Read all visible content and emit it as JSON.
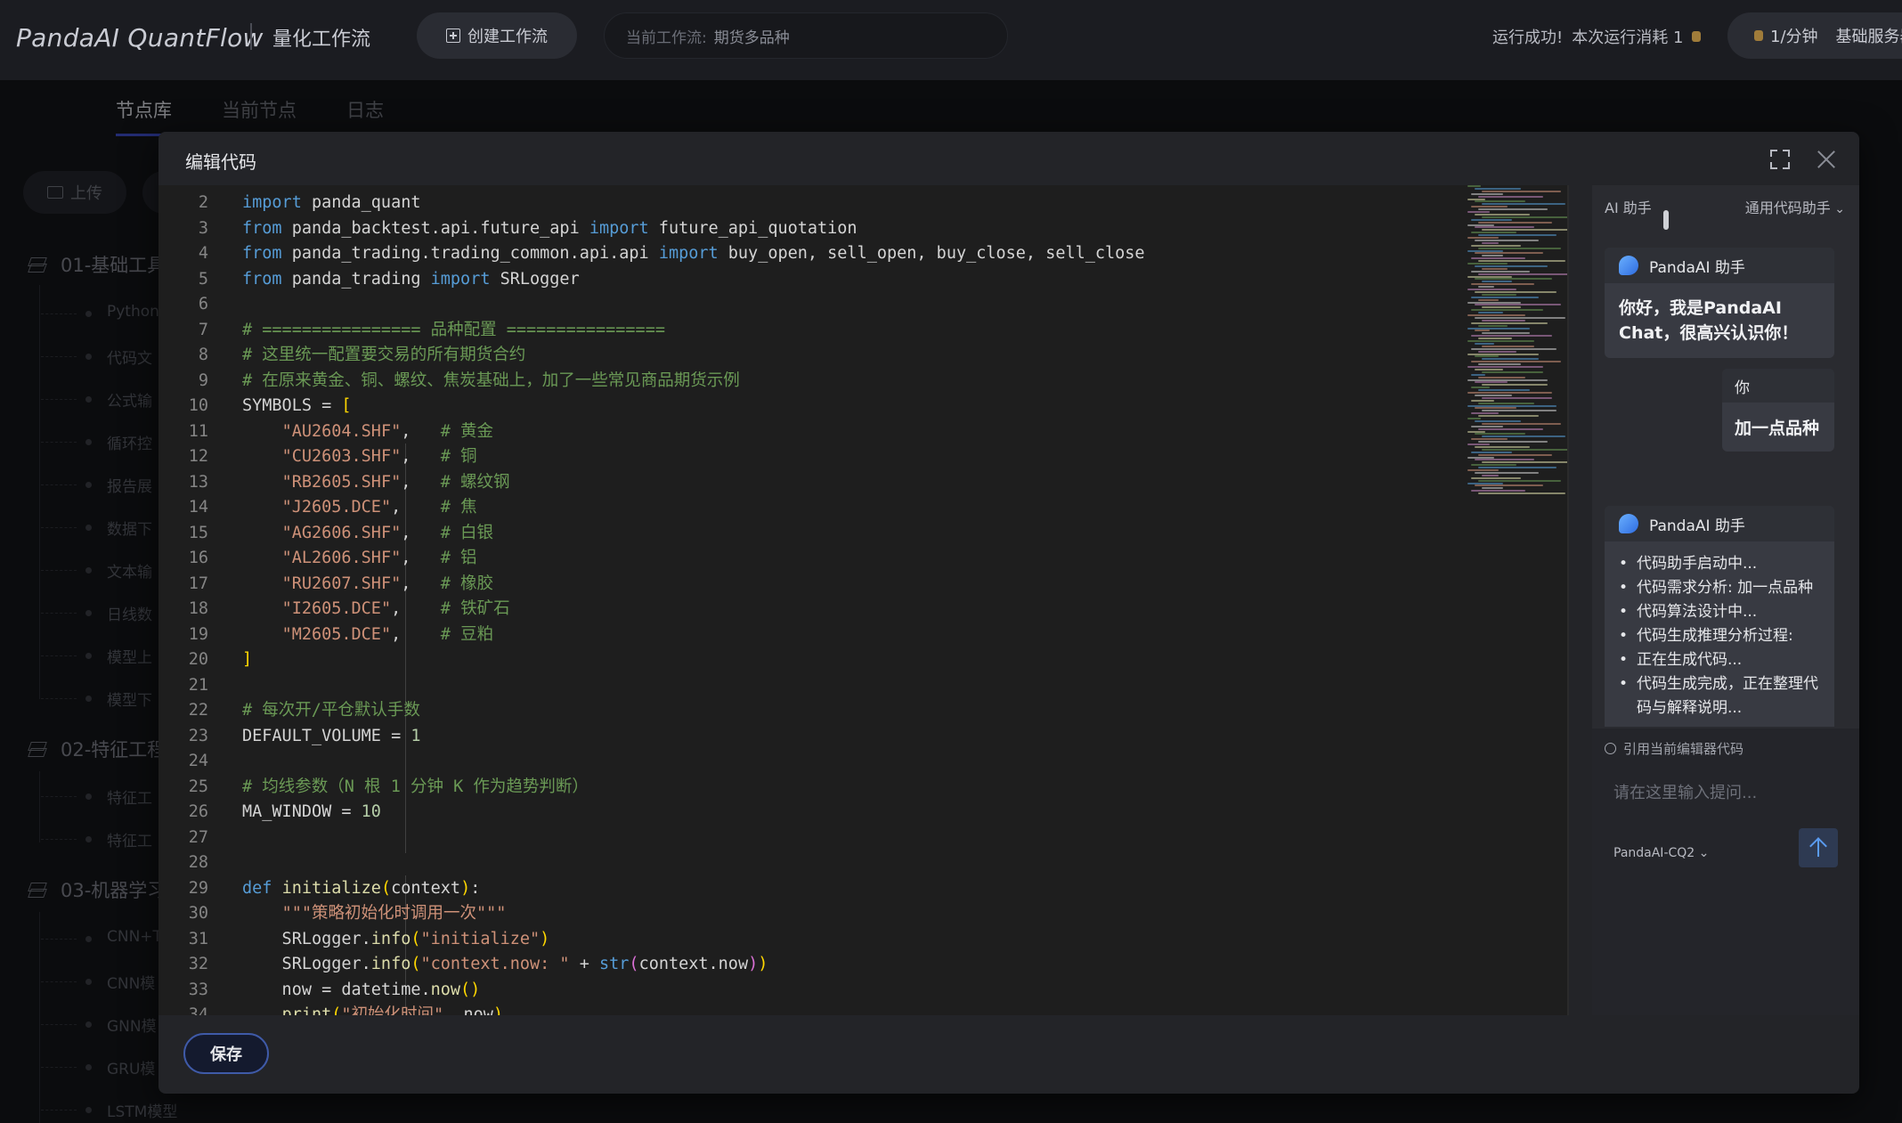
{
  "app": {
    "brand": "PandaAI QuantFlow",
    "subtitle": "量化工作流",
    "create_label": "创建工作流",
    "current_wf_label": "当前工作流:",
    "current_wf_value": "期货多品种",
    "run_status": "运行成功!",
    "run_cost": "本次运行消耗 1",
    "rate": "1/分钟",
    "service": "基础服务器"
  },
  "bg": {
    "tabs": [
      "节点库",
      "当前节点",
      "日志"
    ],
    "upload_label": "上传",
    "categories": [
      "01-基础工具",
      "02-特征工程",
      "03-机器学习"
    ],
    "group1": [
      "Python",
      "代码文",
      "公式输",
      "循环控",
      "报告展",
      "数据下",
      "文本输",
      "日线数",
      "模型上",
      "模型下"
    ],
    "group2": [
      "特征工",
      "特征工"
    ],
    "group3": [
      "CNN+T",
      "CNN模",
      "GNN模",
      "GRU模",
      "LSTM模型"
    ]
  },
  "modal": {
    "title": "编辑代码",
    "save_label": "保存"
  },
  "ai": {
    "title": "AI 助手",
    "mode": "通用代码助手",
    "bot_name": "PandaAI 助手",
    "greeting": "你好，我是PandaAI Chat，很高兴认识你！",
    "user_name": "你",
    "user_msg": "加一点品种",
    "steps": [
      "代码助手启动中...",
      "代码需求分析: 加一点品种",
      "代码算法设计中...",
      "代码生成推理分析过程:",
      "正在生成代码...",
      "代码生成完成，正在整理代码与解释说明..."
    ],
    "ref_label": "引用当前编辑器代码",
    "input_placeholder": "请在这里输入提问...",
    "model": "PandaAI-CQ2"
  }
}
